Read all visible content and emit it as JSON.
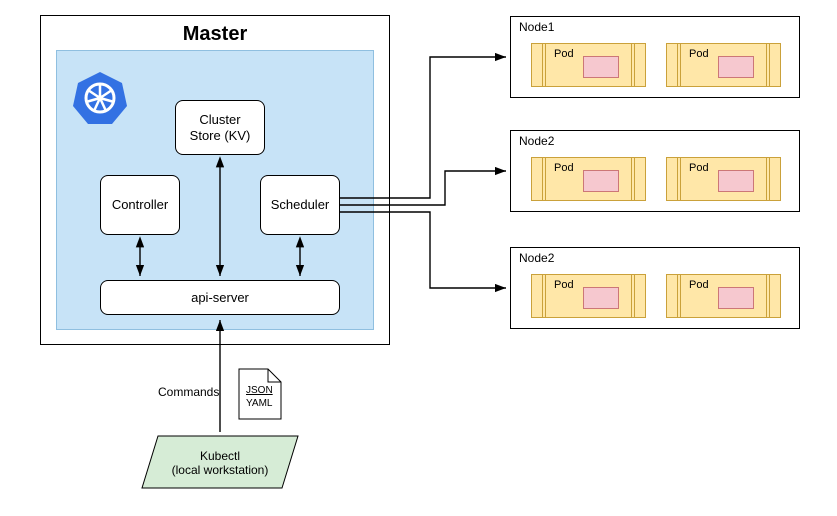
{
  "master": {
    "title": "Master",
    "components": {
      "cluster_store": "Cluster\nStore (KV)",
      "controller": "Controller",
      "scheduler": "Scheduler",
      "api_server": "api-server"
    }
  },
  "client": {
    "commands_label": "Commands",
    "file_labels": [
      "JSON",
      "YAML"
    ],
    "kubectl": "Kubectl\n(local workstation)"
  },
  "nodes": [
    {
      "name": "Node1",
      "pods": [
        "Pod",
        "Pod"
      ]
    },
    {
      "name": "Node2",
      "pods": [
        "Pod",
        "Pod"
      ]
    },
    {
      "name": "Node2",
      "pods": [
        "Pod",
        "Pod"
      ]
    }
  ]
}
